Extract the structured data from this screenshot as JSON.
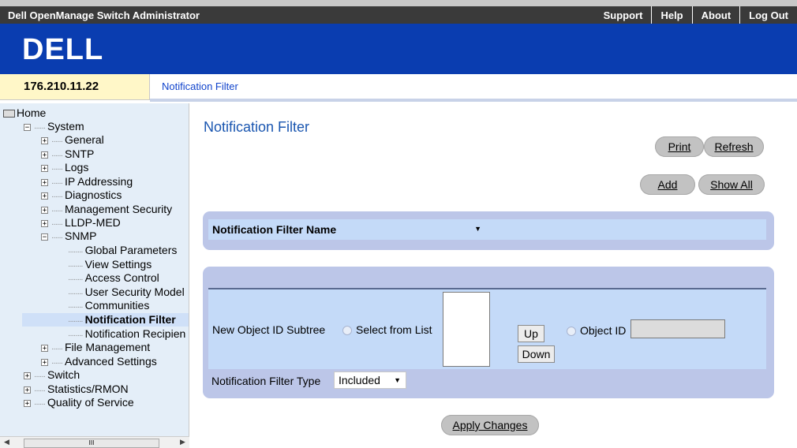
{
  "topbar": {
    "title": "Dell OpenManage Switch Administrator",
    "links": [
      "Support",
      "Help",
      "About",
      "Log Out"
    ]
  },
  "brand": {
    "logo_text": "DELL",
    "background": "#0a3db0"
  },
  "crumbbar": {
    "ip": "176.210.11.22",
    "breadcrumb": "Notification Filter"
  },
  "sidebar": {
    "home": "Home",
    "system": "System",
    "system_children": [
      "General",
      "SNTP",
      "Logs",
      "IP Addressing",
      "Diagnostics",
      "Management Security",
      "LLDP-MED",
      "SNMP"
    ],
    "snmp_children": [
      "Global Parameters",
      "View Settings",
      "Access Control",
      "User Security Model",
      "Communities",
      "Notification Filter",
      "Notification Recipien"
    ],
    "system_tail": [
      "File Management",
      "Advanced Settings"
    ],
    "root_tail": [
      "Switch",
      "Statistics/RMON",
      "Quality of Service"
    ],
    "selected": "Notification Filter",
    "scroll_thumb": "III"
  },
  "main": {
    "title": "Notification Filter",
    "buttons": {
      "print": "Print",
      "refresh": "Refresh",
      "add": "Add",
      "show_all": "Show All",
      "apply": "Apply Changes"
    },
    "filter_name": {
      "label": "Notification Filter Name",
      "value": ""
    },
    "subtree": {
      "label": "New Object ID Subtree",
      "select_from_list": "Select from List",
      "up": "Up",
      "down": "Down",
      "object_id": "Object ID",
      "object_id_value": ""
    },
    "filter_type": {
      "label": "Notification Filter Type",
      "value": "Included"
    }
  },
  "colors": {
    "accent": "#1a56b0",
    "panel": "#bcc6e8",
    "row": "#c4daf8",
    "sidebar": "#e4eef8",
    "topbar": "#3a3a3a"
  }
}
